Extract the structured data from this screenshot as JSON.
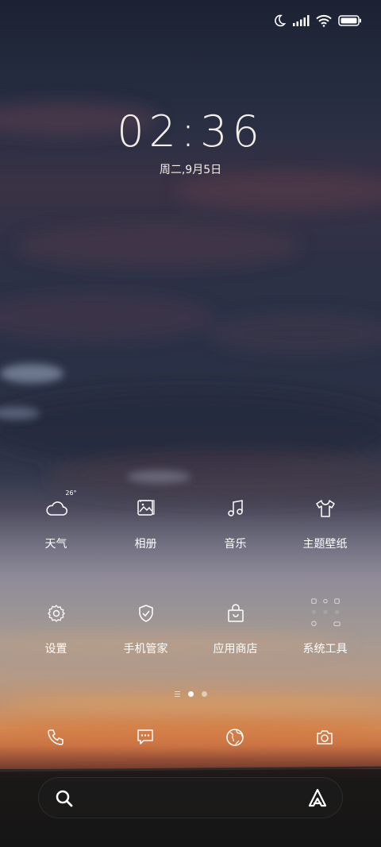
{
  "status_bar": {
    "icons": [
      "moon-icon",
      "signal-icon",
      "wifi-icon",
      "battery-icon"
    ]
  },
  "lockscreen": {
    "time": "02:36",
    "date": "周二,9月5日"
  },
  "apps": [
    {
      "name": "weather",
      "label": "天气",
      "icon": "cloud-icon",
      "badge": "26°"
    },
    {
      "name": "gallery",
      "label": "相册",
      "icon": "gallery-icon"
    },
    {
      "name": "music",
      "label": "音乐",
      "icon": "music-note-icon"
    },
    {
      "name": "themes",
      "label": "主题壁纸",
      "icon": "tshirt-icon"
    },
    {
      "name": "settings",
      "label": "设置",
      "icon": "gear-icon"
    },
    {
      "name": "security",
      "label": "手机管家",
      "icon": "shield-check-icon"
    },
    {
      "name": "app-store",
      "label": "应用商店",
      "icon": "shopping-bag-icon"
    },
    {
      "name": "system-tools",
      "label": "系统工具",
      "icon": "folder-grid-icon"
    }
  ],
  "pager": {
    "pages": 2,
    "active": 0
  },
  "dock": [
    "phone-icon",
    "message-icon",
    "browser-icon",
    "camera-icon"
  ],
  "search": {
    "left_icon": "search-icon",
    "right_icon": "assistant-icon"
  }
}
